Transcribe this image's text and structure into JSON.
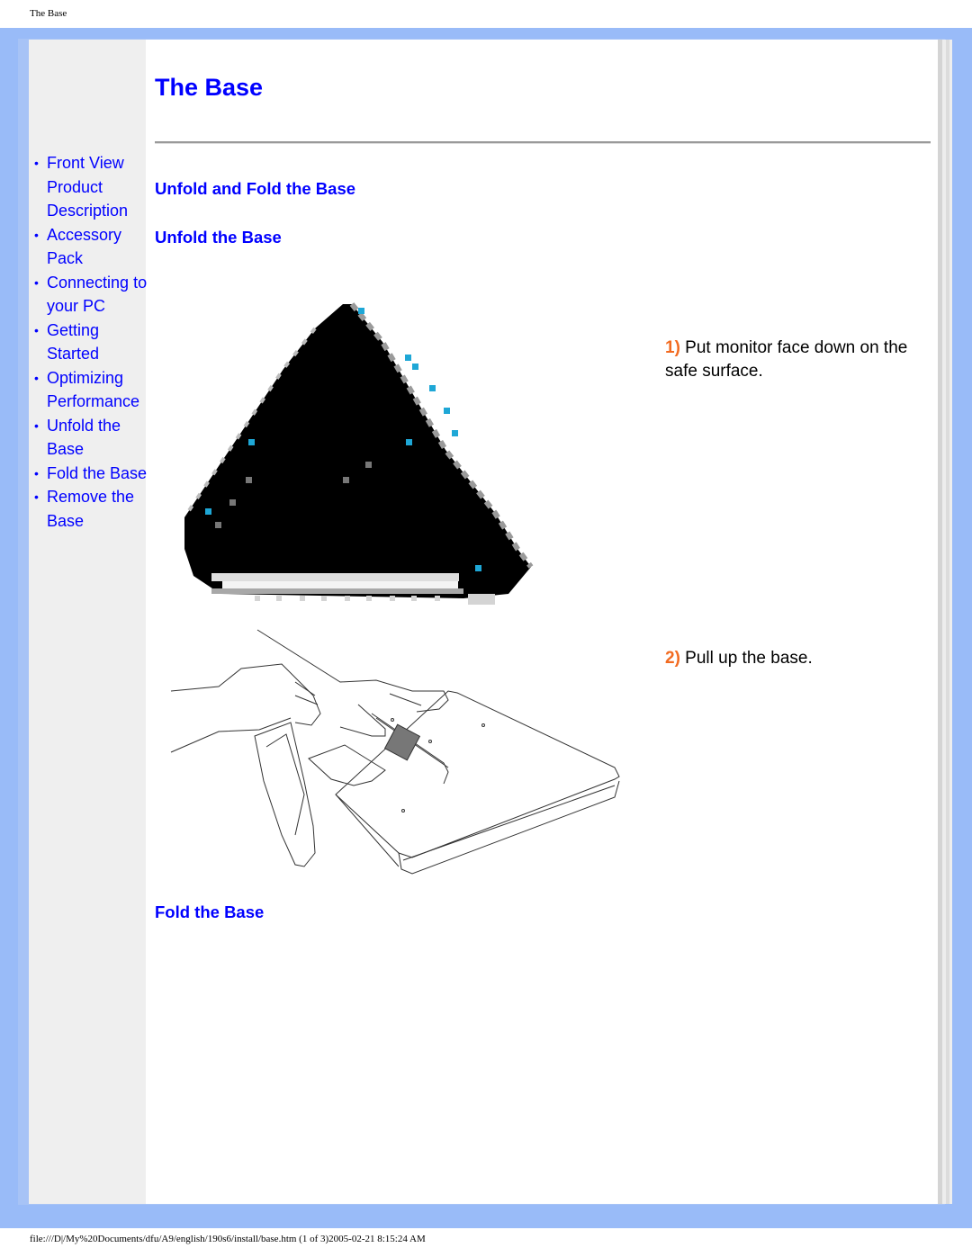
{
  "page_header": "The Base",
  "title": "The Base",
  "nav": {
    "items": [
      {
        "label": "Front View Product Description"
      },
      {
        "label": "Accessory Pack"
      },
      {
        "label": "Connecting to your PC"
      },
      {
        "label": "Getting Started"
      },
      {
        "label": "Optimizing Performance"
      },
      {
        "label": "Unfold the Base"
      },
      {
        "label": "Fold the Base"
      },
      {
        "label": "Remove the Base"
      }
    ],
    "bullet": "•"
  },
  "sections": {
    "unfold_and_fold": "Unfold and Fold the Base",
    "unfold": "Unfold the Base",
    "fold": "Fold the Base"
  },
  "steps": [
    {
      "number": "1)",
      "text": " Put monitor face down on the safe surface."
    },
    {
      "number": "2)",
      "text": " Pull up the base."
    }
  ],
  "images": {
    "monitor_face_down": "monitor-face-down-image",
    "pull_up_base": "pull-up-base-illustration"
  },
  "colors": {
    "link": "#0000ff",
    "step_number": "#f26b21",
    "frame": "#99bbf8",
    "sidebar": "#efefef"
  },
  "page_footer": "file:///D|/My%20Documents/dfu/A9/english/190s6/install/base.htm (1 of 3)2005-02-21 8:15:24 AM"
}
